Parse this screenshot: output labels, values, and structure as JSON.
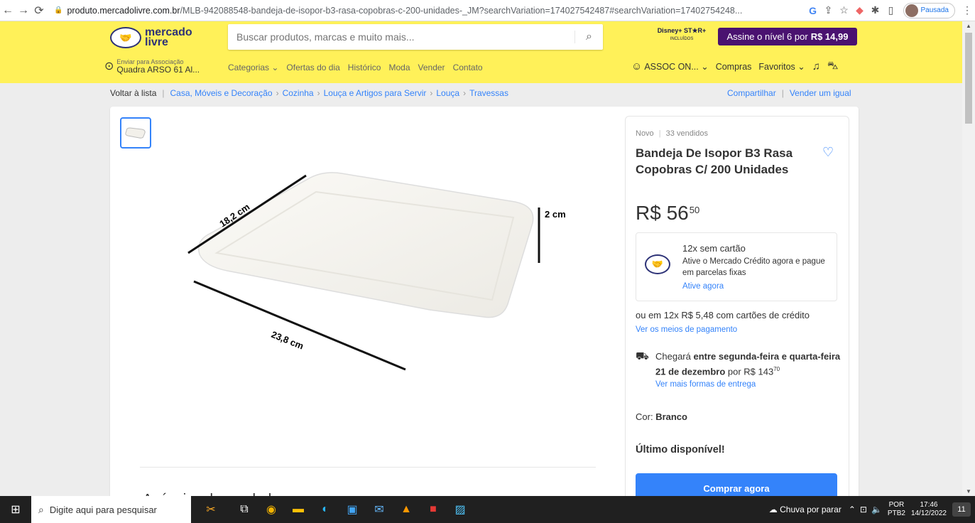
{
  "browser": {
    "url_host": "produto.mercadolivre.com.br",
    "url_path": "/MLB-942088548-bandeja-de-isopor-b3-rasa-copobras-c-200-unidades-_JM?searchVariation=174027542487#searchVariation=17402754248...",
    "profile_label": "Pausada"
  },
  "header": {
    "logo_line1": "mercado",
    "logo_line2": "livre",
    "search_placeholder": "Buscar produtos, marcas e muito mais...",
    "disney_label": "Disney+ ST★R+",
    "disney_sub": "INCLUÍDOS",
    "promo_text": "Assine o nível 6 por",
    "promo_price": "R$ 14,99",
    "ship_line1": "Enviar para Associação",
    "ship_line2": "Quadra ARSO 61 Al...",
    "nav": [
      "Categorias ⌄",
      "Ofertas do dia",
      "Histórico",
      "Moda",
      "Vender",
      "Contato"
    ],
    "user": "ASSOC ON... ⌄",
    "purchases": "Compras",
    "favorites": "Favoritos ⌄"
  },
  "breadcrumb": {
    "back": "Voltar à lista",
    "items": [
      "Casa, Móveis e Decoração",
      "Cozinha",
      "Louça e Artigos para Servir",
      "Louça",
      "Travessas"
    ],
    "share": "Compartilhar",
    "sell_same": "Vender um igual"
  },
  "gallery": {
    "dim_width": "23,8 cm",
    "dim_depth": "18,2 cm",
    "dim_height": "2 cm"
  },
  "below_title": "Anúncios do vendedor",
  "product": {
    "condition": "Novo",
    "sold": "33 vendidos",
    "title": "Bandeja De Isopor B3 Rasa Copobras C/ 200 Unidades",
    "price_currency": "R$",
    "price_int": "56",
    "price_cents": "50",
    "credit_title": "12x sem cartão",
    "credit_desc": "Ative o Mercado Crédito agora e pague em parcelas fixas",
    "credit_link": "Ative agora",
    "installments": "ou em 12x R$ 5,48 com cartões de crédito",
    "payment_link": "Ver os meios de pagamento",
    "delivery_prefix": "Chegará",
    "delivery_bold": "entre segunda-feira e quarta-feira 21 de dezembro",
    "delivery_suffix": "por R$ 143",
    "delivery_cents": "70",
    "delivery_link": "Ver mais formas de entrega",
    "color_label": "Cor:",
    "color_value": "Branco",
    "stock": "Último disponível!",
    "buy_button": "Comprar agora"
  },
  "taskbar": {
    "search_placeholder": "Digite aqui para pesquisar",
    "weather": "Chuva por parar",
    "lang1": "POR",
    "lang2": "PTB2",
    "time": "17:46",
    "date": "14/12/2022",
    "notif_count": "11"
  },
  "colors": {
    "header_yellow": "#fff159",
    "link_blue": "#3483fa",
    "promo_purple": "#4a1270"
  }
}
